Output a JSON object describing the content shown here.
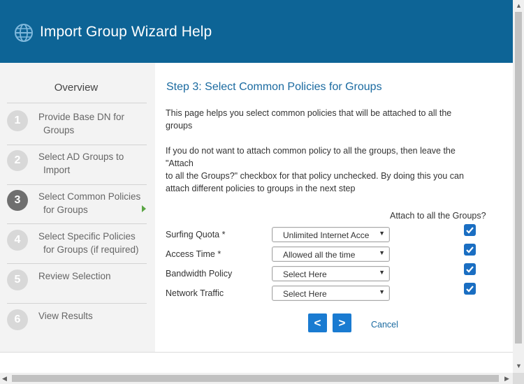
{
  "header": {
    "title": "Import Group Wizard Help",
    "icon": "globe-icon",
    "bg_color": "#0d6496"
  },
  "sidebar": {
    "overview": "Overview",
    "steps": [
      {
        "number": "1",
        "line1": "Provide Base DN for",
        "line2": "Groups",
        "active": false
      },
      {
        "number": "2",
        "line1": "Select AD Groups to",
        "line2": "Import",
        "active": false
      },
      {
        "number": "3",
        "line1": "Select Common Policies",
        "line2": "for Groups",
        "active": true
      },
      {
        "number": "4",
        "line1": "Select Specific Policies",
        "line2": "for Groups (if required)",
        "active": false
      },
      {
        "number": "5",
        "line1": "Review Selection",
        "line2": "",
        "active": false
      },
      {
        "number": "6",
        "line1": "View Results",
        "line2": "",
        "active": false
      }
    ]
  },
  "main": {
    "heading": "Step 3: Select Common Policies for Groups",
    "para1_line1": "This page helps you select common policies that will be attached to all the",
    "para1_line2": "groups",
    "para2_line1": "If you do not want to attach common policy to all the groups, then leave the",
    "para2_line2": "\"Attach",
    "para2_line3": "to all the Groups?\" checkbox for that policy unchecked. By doing this you can",
    "para2_line4": "attach different policies to groups in the next step",
    "attach_header": "Attach to all the Groups?",
    "policies": [
      {
        "label": "Surfing Quota *",
        "selected": "Unlimited Internet Acce",
        "attach_all": true
      },
      {
        "label": "Access Time *",
        "selected": "Allowed all the time",
        "attach_all": true
      },
      {
        "label": "Bandwidth Policy",
        "selected": "Select Here",
        "attach_all": true
      },
      {
        "label": "Network Traffic",
        "selected": "Select Here",
        "attach_all": true
      }
    ],
    "buttons": {
      "prev": "<",
      "next": ">",
      "cancel": "Cancel"
    }
  },
  "colors": {
    "accent": "#1a7bd1",
    "heading": "#1a6aa0",
    "active_arrow": "#5aa544"
  }
}
